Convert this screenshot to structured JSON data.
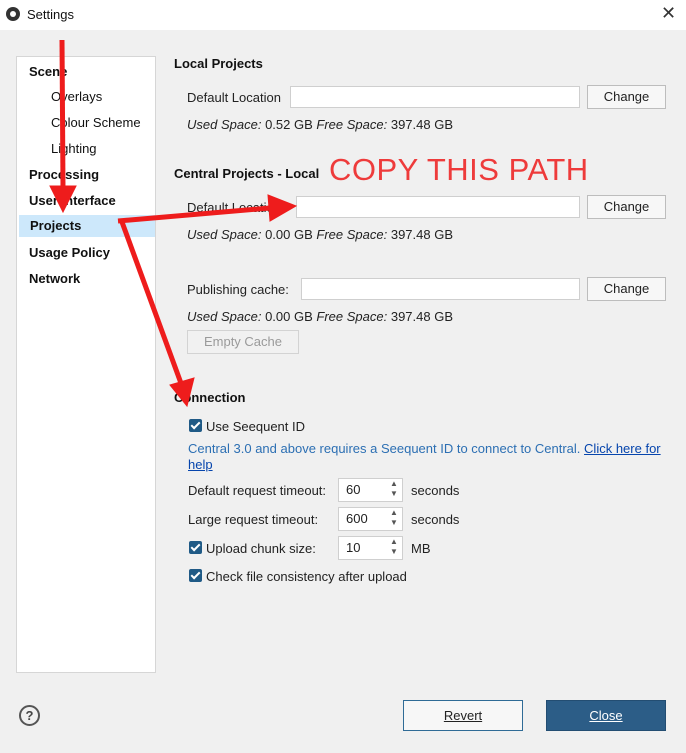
{
  "window": {
    "title": "Settings",
    "close_glyph": "✕"
  },
  "sidebar": {
    "items": [
      {
        "label": "Scene"
      },
      {
        "label": "Overlays"
      },
      {
        "label": "Colour Scheme"
      },
      {
        "label": "Lighting"
      },
      {
        "label": "Processing"
      },
      {
        "label": "User Interface"
      },
      {
        "label": "Projects"
      },
      {
        "label": "Usage Policy"
      },
      {
        "label": "Network"
      }
    ],
    "selected": "Projects"
  },
  "local_projects": {
    "title": "Local Projects",
    "default_location_label": "Default Location",
    "default_location_value": "",
    "change_label": "Change",
    "used_space_label": "Used Space:",
    "used_space_value": "0.52 GB",
    "free_space_label": "Free Space:",
    "free_space_value": "397.48 GB"
  },
  "central_projects": {
    "title": "Central Projects - Local",
    "default_location_label": "Default Location",
    "default_location_value": "",
    "change_label": "Change",
    "used_space_label": "Used Space:",
    "used_space_value": "0.00 GB",
    "free_space_label": "Free Space:",
    "free_space_value": "397.48 GB",
    "publishing_cache_label": "Publishing cache:",
    "publishing_cache_value": "",
    "publishing_change_label": "Change",
    "cache_used_space_value": "0.00 GB",
    "cache_free_space_value": "397.48 GB",
    "empty_cache_label": "Empty Cache"
  },
  "connection": {
    "title": "Connection",
    "use_seequent_id_label": "Use Seequent ID",
    "use_seequent_id_checked": true,
    "info_text": "Central 3.0 and above requires a Seequent ID to connect to Central.",
    "help_link": "Click here for help",
    "default_timeout_label": "Default request timeout:",
    "default_timeout_value": "60",
    "large_timeout_label": "Large request timeout:",
    "large_timeout_value": "600",
    "seconds_label": "seconds",
    "upload_chunk_label": "Upload chunk size:",
    "upload_chunk_checked": true,
    "upload_chunk_value": "10",
    "mb_label": "MB",
    "check_consistency_label": "Check file consistency after upload",
    "check_consistency_checked": true
  },
  "footer": {
    "help_glyph": "?",
    "revert_label": "Revert",
    "close_label": "Close"
  },
  "annotation": {
    "text": "COPY THIS PATH",
    "color": "#ee3b3b"
  },
  "colors": {
    "selection": "#cde8fb",
    "primary_button": "#2c5d87",
    "link": "#0645ad",
    "info": "#2c6fb3"
  }
}
